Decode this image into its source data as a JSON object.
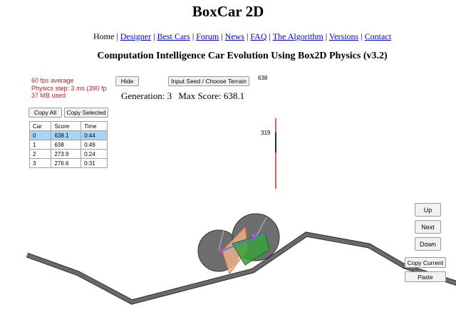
{
  "title": "BoxCar 2D",
  "nav": [
    {
      "label": "Home",
      "link": false
    },
    {
      "label": "Designer",
      "link": true
    },
    {
      "label": "Best Cars",
      "link": true
    },
    {
      "label": "Forum",
      "link": true
    },
    {
      "label": "News",
      "link": true
    },
    {
      "label": "FAQ",
      "link": true
    },
    {
      "label": "The Algorithm",
      "link": true
    },
    {
      "label": "Versions",
      "link": true
    },
    {
      "label": "Contact",
      "link": true
    }
  ],
  "subtitle": "Computation Intelligence Car Evolution Using Box2D Physics (v3.2)",
  "stats": {
    "fps": "60 fps average",
    "physics": "Physics step: 3 ms (390 fp",
    "memory": "37 MB used"
  },
  "buttons": {
    "hide": "Hide",
    "seed": "Input Seed / Choose Terrain",
    "copy_all": "Copy All",
    "copy_selected": "Copy Selected",
    "up": "Up",
    "next": "Next",
    "down": "Down",
    "copy_current": "Copy Current",
    "paste": "Paste"
  },
  "generation": {
    "label": "Generation: 3",
    "max_score": "Max Score: 638.1"
  },
  "graph": {
    "top_label": "638",
    "mid_label": "319"
  },
  "table": {
    "headers": [
      "Car",
      "Score",
      "Time"
    ],
    "rows": [
      [
        "0",
        "638.1",
        "0:44"
      ],
      [
        "1",
        "638",
        "0:49"
      ],
      [
        "2",
        "273.9",
        "0:24"
      ],
      [
        "3",
        "276.6",
        "0:31"
      ]
    ],
    "selected_row": 0
  },
  "colors": {
    "selected_row": "#aad4f5",
    "stats_text": "#b02020",
    "link": "#0000cc",
    "track": "#555555",
    "wheel": "#707070",
    "car_body_orange": "#f4b48a",
    "car_body_green": "#3aa23a",
    "graph_red": "#dd2222"
  }
}
